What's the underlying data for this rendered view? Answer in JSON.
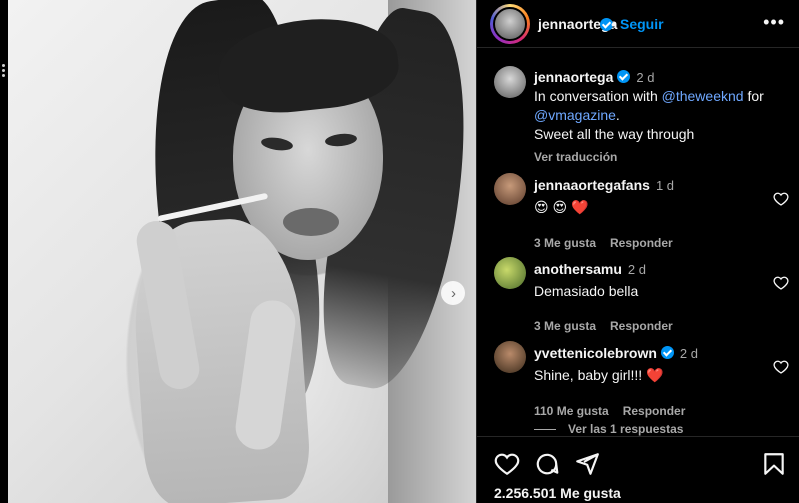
{
  "header": {
    "username": "jennaortega",
    "separator": "•",
    "follow_label": "Seguir",
    "more_label": "•••"
  },
  "caption": {
    "username": "jennaortega",
    "time": "2 d",
    "line1_prefix": "In conversation with ",
    "mention1": "@theweeknd",
    "line1_suffix": " for",
    "mention2": "@vmagazine",
    "line2_suffix": ".",
    "line3": "Sweet all the way through",
    "translate": "Ver traducción"
  },
  "comments": [
    {
      "username": "jennaaortegafans",
      "time": "1 d",
      "text": "😍 😍 ❤️",
      "likes": "3 Me gusta",
      "reply": "Responder"
    },
    {
      "username": "anothersamu",
      "time": "2 d",
      "text": "Demasiado bella",
      "likes": "3 Me gusta",
      "reply": "Responder"
    },
    {
      "username": "yvettenicolebrown",
      "time": "2 d",
      "text": "Shine, baby girl!!! ❤️",
      "likes": "110 Me gusta",
      "reply": "Responder"
    }
  ],
  "replies_label": "Ver las 1 respuestas",
  "likes_count": "2.256.501 Me gusta",
  "icons": [
    "heart-icon",
    "comment-icon",
    "share-icon",
    "bookmark-icon",
    "chevron-right-icon",
    "verified-badge-icon"
  ],
  "colors": {
    "accent": "#0095f6",
    "background": "#000000",
    "muted": "#a8a8a8",
    "heart": "#ff3040"
  }
}
